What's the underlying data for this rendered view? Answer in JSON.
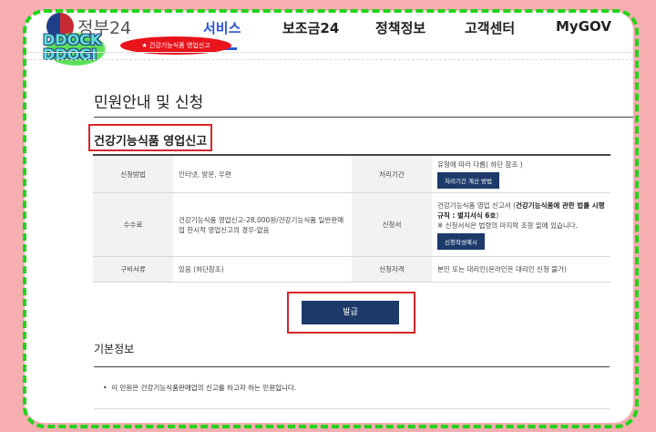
{
  "header": {
    "logo_text": "정부24",
    "sticker_text": "DDOCK DDOGI",
    "nav": [
      {
        "label": "서비스"
      },
      {
        "label": "보조금24"
      },
      {
        "label": "정책정보"
      },
      {
        "label": "고객센터"
      },
      {
        "label": "MyGOV"
      }
    ],
    "highlight_pill": "★ 건강기능식품 영업신고"
  },
  "page": {
    "title": "민원안내 및 신청",
    "service_title": "건강기능식품 영업신고"
  },
  "info_table": {
    "rows": [
      {
        "h1": "신청방법",
        "v1": "인터넷, 방문, 우편",
        "h2": "처리기간",
        "v2": "유형에 따라 다름( 하단 참조 )",
        "btn": "처리기간 계산 방법"
      },
      {
        "h1": "수수료",
        "v1": "건강기능식품 영업신고-28,000원/건강기능식품 일반판매업 한시적 영업신고의 경우-없음",
        "h2": "신청서",
        "v2_plain": "건강기능식품 영업 신고서 (",
        "v2_bold": "건강기능식품에 관한 법률 시행규칙 : 별지서식 6호",
        "v2_end": ")",
        "v2_note": "※ 신청서식은 법령의 마지막 조항 밑에 있습니다.",
        "btn": "신청작성예시"
      },
      {
        "h1": "구비서류",
        "v1": "있음 (하단참조)",
        "h2": "신청자격",
        "v2": "본인 또는 대리인(온라인은 대리인 신청 불가)"
      }
    ]
  },
  "issue_button": "발급",
  "basic_info": {
    "title": "기본정보",
    "bullets": [
      "이 민원은 건강기능식품판매업의 신고를 하고자 하는 민원입니다."
    ]
  },
  "colors": {
    "accent": "#2a56d6",
    "button": "#1e3a6b",
    "highlight": "#d7262c",
    "frame": "#22d41c",
    "background": "#f6aeb0"
  }
}
